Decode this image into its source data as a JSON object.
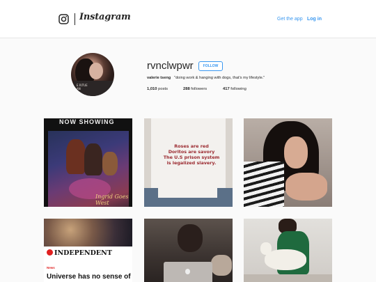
{
  "header": {
    "logo_icon": "instagram-camera-icon",
    "wordmark": "Instagram",
    "get_app_label": "Get the app",
    "login_label": "Log in",
    "link_color": "#3897f0"
  },
  "profile": {
    "username": "rvnclwpwr",
    "follow_label": "FOLLOW",
    "full_name": "valerie tseng",
    "bio": "\"doing work & hanging with dogs, that's my lifestyle.\"",
    "stats": {
      "posts_count": "1,010",
      "posts_label": "posts",
      "followers_count": "288",
      "followers_label": "followers",
      "following_count": "417",
      "following_label": "following"
    }
  },
  "posts": [
    {
      "type": "image",
      "subject": "movie-poster",
      "poster_top_text": "NOW SHOWING",
      "poster_script": "Ingrid Goes West"
    },
    {
      "type": "image",
      "subject": "t-shirt",
      "shirt_text_lines": [
        "Roses are red",
        "Doritos are savory",
        "The U.S prison system",
        "is legalized slavery."
      ]
    },
    {
      "type": "image",
      "subject": "portrait"
    },
    {
      "type": "image",
      "subject": "news-article",
      "masthead": "INDEPENDENT",
      "category": "News",
      "headline": "Universe has no sense of"
    },
    {
      "type": "image",
      "subject": "laptop-dog"
    },
    {
      "type": "image",
      "subject": "woman-with-dog"
    }
  ]
}
